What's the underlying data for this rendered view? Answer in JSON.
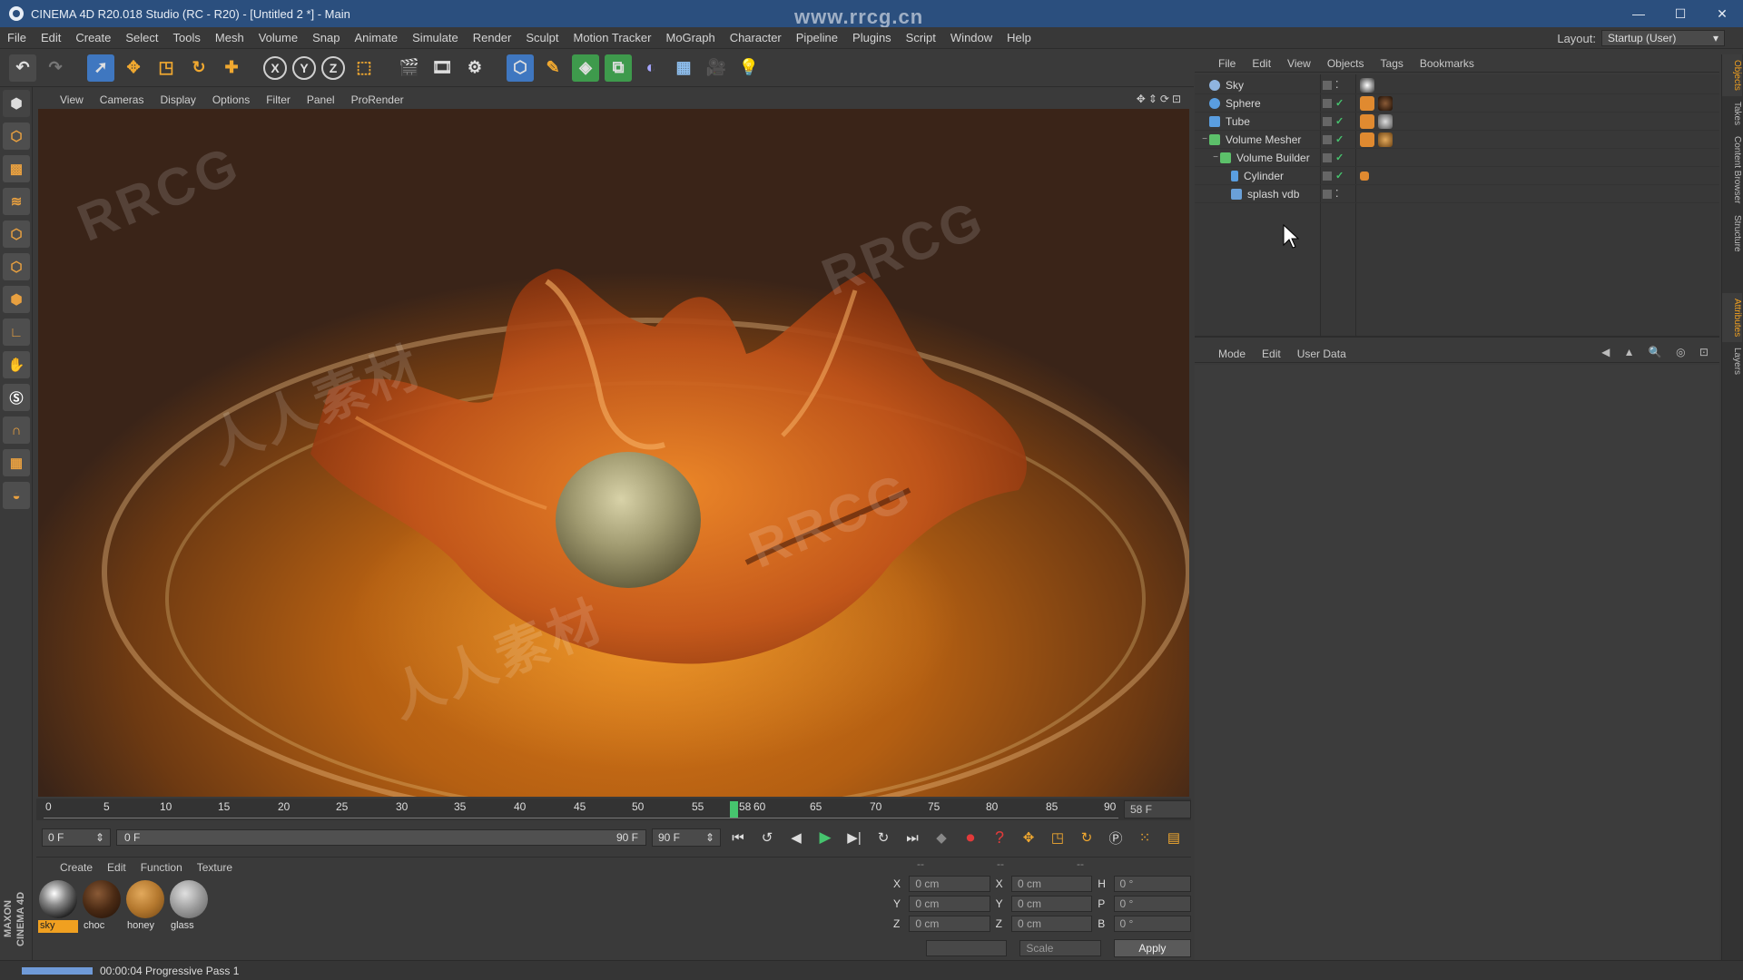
{
  "window": {
    "title": "CINEMA 4D R20.018 Studio (RC - R20) - [Untitled 2 *] - Main",
    "watermark_url": "www.rrcg.cn",
    "controls": [
      "—",
      "☐",
      "✕"
    ]
  },
  "menubar": {
    "items": [
      "File",
      "Edit",
      "Create",
      "Select",
      "Tools",
      "Mesh",
      "Volume",
      "Snap",
      "Animate",
      "Simulate",
      "Render",
      "Sculpt",
      "Motion Tracker",
      "MoGraph",
      "Character",
      "Pipeline",
      "Plugins",
      "Script",
      "Window",
      "Help"
    ],
    "layout_label": "Layout:",
    "layout_value": "Startup (User)"
  },
  "toolbar": {
    "icons": [
      "undo-icon",
      "redo-icon",
      "select-icon",
      "move-icon",
      "scale-icon",
      "rotate-icon",
      "add-icon",
      "x-axis-icon",
      "y-axis-icon",
      "z-axis-icon",
      "coordinate-system-icon",
      "render-view-icon",
      "render-picture-viewer-icon",
      "render-settings-icon",
      "cube-icon",
      "pen-icon",
      "subdivision-icon",
      "array-icon",
      "deformer-icon",
      "floor-icon",
      "camera-icon",
      "light-icon"
    ],
    "axis_x": "X",
    "axis_y": "Y",
    "axis_z": "Z"
  },
  "viewport": {
    "menu": [
      "View",
      "Cameras",
      "Display",
      "Options",
      "Filter",
      "Panel",
      "ProRender"
    ]
  },
  "timeline": {
    "ticks": [
      "0",
      "5",
      "10",
      "15",
      "20",
      "25",
      "30",
      "35",
      "40",
      "45",
      "50",
      "55",
      "58",
      "60",
      "65",
      "70",
      "75",
      "80",
      "85",
      "90"
    ],
    "current_frame": 58,
    "end_field": "58 F",
    "start_field": "0 F",
    "range_start": "0 F",
    "range_end": "90 F",
    "max_field": "90 F"
  },
  "materials": {
    "menu": [
      "Create",
      "Edit",
      "Function",
      "Texture"
    ],
    "items": [
      {
        "name": "sky",
        "selected": true
      },
      {
        "name": "choc",
        "selected": false
      },
      {
        "name": "honey",
        "selected": false
      },
      {
        "name": "glass",
        "selected": false
      }
    ],
    "brand": "MAXON CINEMA 4D"
  },
  "coordinates": {
    "headers": [
      "--",
      "--",
      "--"
    ],
    "rows": [
      {
        "a": "X",
        "av": "0 cm",
        "b": "X",
        "bv": "0 cm",
        "c": "H",
        "cv": "0 °"
      },
      {
        "a": "Y",
        "av": "0 cm",
        "b": "Y",
        "bv": "0 cm",
        "c": "P",
        "cv": "0 °"
      },
      {
        "a": "Z",
        "av": "0 cm",
        "b": "Z",
        "bv": "0 cm",
        "c": "B",
        "cv": "0 °"
      }
    ],
    "mode_select": "",
    "scale_select": "Scale",
    "apply": "Apply"
  },
  "status": {
    "text": "00:00:04 Progressive Pass 1"
  },
  "object_manager": {
    "menu": [
      "File",
      "Edit",
      "View",
      "Objects",
      "Tags",
      "Bookmarks"
    ],
    "objects": [
      {
        "name": "Sky",
        "indent": 0,
        "expander": "",
        "icon_color": "#8fb4e0"
      },
      {
        "name": "Sphere",
        "indent": 0,
        "expander": "",
        "icon_color": "#5a9ee0"
      },
      {
        "name": "Tube",
        "indent": 0,
        "expander": "",
        "icon_color": "#5a9ee0"
      },
      {
        "name": "Volume Mesher",
        "indent": 0,
        "expander": "−",
        "icon_color": "#5cc06a"
      },
      {
        "name": "Volume Builder",
        "indent": 1,
        "expander": "−",
        "icon_color": "#5cc06a"
      },
      {
        "name": "Cylinder",
        "indent": 2,
        "expander": "",
        "icon_color": "#5a9ee0"
      },
      {
        "name": "splash vdb",
        "indent": 2,
        "expander": "",
        "icon_color": "#6aa0d8"
      }
    ]
  },
  "attribute_manager": {
    "menu": [
      "Mode",
      "Edit",
      "User Data"
    ],
    "icons": "◀ ▲ 🔍 ◎ ⊡"
  },
  "right_tabs": [
    "Objects",
    "Takes",
    "Content Browser",
    "Structure",
    "Attributes",
    "Layers"
  ],
  "watermark_text": "RRCG",
  "watermark_cn": "人人素材",
  "colors": {
    "accent_orange": "#f0a020",
    "playhead_green": "#46c46e",
    "title_blue": "#2b4f7e"
  }
}
